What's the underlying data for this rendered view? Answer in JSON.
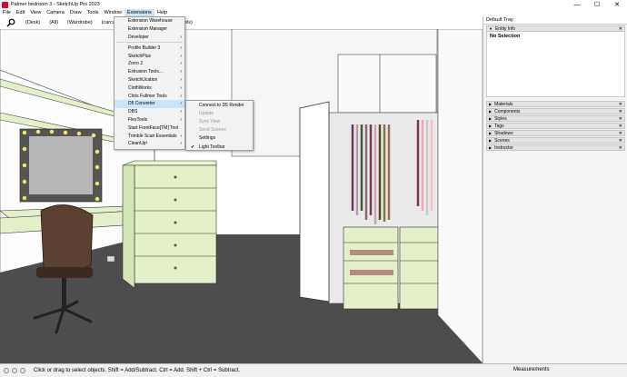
{
  "window": {
    "title": "Palmer bedroom 3 - SketchUp Pro 2023",
    "minimize": "—",
    "maximize": "☐",
    "close": "✕"
  },
  "menubar": {
    "items": [
      "File",
      "Edit",
      "View",
      "Camera",
      "Draw",
      "Tools",
      "Window",
      "Extensions",
      "Help"
    ],
    "open_menu": "Extensions"
  },
  "toolbar": {
    "search_icon": "magnifier-icon",
    "scenes": [
      "(Desk)",
      "(All)",
      "(Wardrobe)",
      "(carcas",
      "rs panels)"
    ]
  },
  "extensions_menu": {
    "items": [
      {
        "label": "Extension Warehouse",
        "submenu": false
      },
      {
        "label": "Extension Manager",
        "submenu": false
      },
      {
        "label": "Developer",
        "submenu": true
      },
      {
        "label": "Profile Builder 3",
        "submenu": true
      },
      {
        "label": "SketchPlus",
        "submenu": true
      },
      {
        "label": "Zorro 2",
        "submenu": true
      },
      {
        "label": "Extrusion Tools...",
        "submenu": true
      },
      {
        "label": "SketchUcation",
        "submenu": true
      },
      {
        "label": "ClothWorks",
        "submenu": true
      },
      {
        "label": "Chris Fullmer Tools",
        "submenu": true
      },
      {
        "label": "D5 Converter",
        "submenu": true,
        "highlighted": true
      },
      {
        "label": "DBS",
        "submenu": true
      },
      {
        "label": "FlexTools",
        "submenu": true
      },
      {
        "label": "Start FrontFace[TM] Tool",
        "submenu": false
      },
      {
        "label": "Trimble Scan Essentials",
        "submenu": true
      },
      {
        "label": "CleanUp³",
        "submenu": true
      }
    ]
  },
  "d5_submenu": {
    "items": [
      {
        "label": "Connect to D5 Render",
        "enabled": true,
        "checked": false
      },
      {
        "label": "Update",
        "enabled": false,
        "checked": false
      },
      {
        "label": "Sync View",
        "enabled": false,
        "checked": false
      },
      {
        "label": "Send Scenes",
        "enabled": false,
        "checked": false
      },
      {
        "label": "Settings",
        "enabled": true,
        "checked": false
      },
      {
        "label": "Light Toolbar",
        "enabled": true,
        "checked": true
      }
    ]
  },
  "tray": {
    "title": "Default Tray",
    "entity_info": {
      "label": "Entity Info",
      "value": "No Selection"
    },
    "panels": [
      "Materials",
      "Components",
      "Styles",
      "Tags",
      "Shadows",
      "Scenes",
      "Instructor"
    ]
  },
  "statusbar": {
    "hint": "Click or drag to select objects. Shift = Add/Subtract. Ctrl = Add. Shift + Ctrl = Subtract.",
    "measurements_label": "Measurements"
  },
  "colors": {
    "menu_highlight": "#cce4f7",
    "cabinet_green": "#e3f0c9",
    "floor": "#4d4d4d",
    "wall": "#ffffff"
  }
}
